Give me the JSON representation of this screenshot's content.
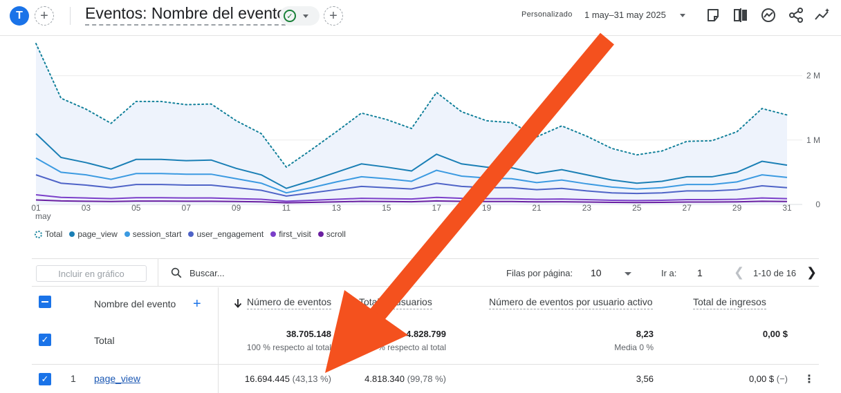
{
  "header": {
    "avatar_letter": "T",
    "title": "Eventos: Nombre del evento",
    "date_label": "Personalizado",
    "date_range": "1 may–31 may 2025",
    "add_comparison_glyph": "+",
    "add_report_glyph": "+"
  },
  "legend": {
    "items": [
      {
        "label": "Total",
        "color": "#12809a"
      },
      {
        "label": "page_view",
        "color": "#1a7fb5"
      },
      {
        "label": "session_start",
        "color": "#3b9ae1"
      },
      {
        "label": "user_engagement",
        "color": "#4e63c7"
      },
      {
        "label": "first_visit",
        "color": "#7b3fc9"
      },
      {
        "label": "scroll",
        "color": "#6a1fa0"
      }
    ]
  },
  "chart_data": {
    "type": "line",
    "x": [
      "01",
      "02",
      "03",
      "04",
      "05",
      "06",
      "07",
      "08",
      "09",
      "10",
      "11",
      "12",
      "13",
      "14",
      "15",
      "16",
      "17",
      "18",
      "19",
      "20",
      "21",
      "22",
      "23",
      "24",
      "25",
      "26",
      "27",
      "28",
      "29",
      "30",
      "31"
    ],
    "x_tick_labels": [
      "01",
      "03",
      "05",
      "07",
      "09",
      "11",
      "13",
      "15",
      "17",
      "19",
      "21",
      "23",
      "25",
      "27",
      "29",
      "31"
    ],
    "x_sub_label": "may",
    "y_tick_labels": [
      "0",
      "1 M",
      "2 M"
    ],
    "ylim": [
      0,
      2500000
    ],
    "grid": true,
    "series": [
      {
        "name": "Total",
        "style": "dotted-area",
        "color": "#12809a",
        "values": [
          2500000,
          1650000,
          1480000,
          1260000,
          1600000,
          1600000,
          1550000,
          1560000,
          1300000,
          1100000,
          580000,
          850000,
          1130000,
          1420000,
          1320000,
          1180000,
          1740000,
          1440000,
          1300000,
          1270000,
          1050000,
          1220000,
          1060000,
          870000,
          770000,
          830000,
          980000,
          990000,
          1130000,
          1490000,
          1390000
        ]
      },
      {
        "name": "page_view",
        "color": "#1a7fb5",
        "values": [
          1100000,
          730000,
          650000,
          550000,
          700000,
          700000,
          680000,
          690000,
          560000,
          460000,
          250000,
          370000,
          500000,
          630000,
          580000,
          520000,
          780000,
          630000,
          580000,
          570000,
          480000,
          540000,
          460000,
          380000,
          330000,
          360000,
          430000,
          430000,
          500000,
          670000,
          610000
        ]
      },
      {
        "name": "session_start",
        "color": "#3b9ae1",
        "values": [
          720000,
          500000,
          460000,
          390000,
          480000,
          480000,
          470000,
          470000,
          400000,
          330000,
          180000,
          260000,
          350000,
          430000,
          400000,
          360000,
          530000,
          440000,
          410000,
          400000,
          340000,
          380000,
          320000,
          270000,
          240000,
          260000,
          310000,
          310000,
          350000,
          460000,
          420000
        ]
      },
      {
        "name": "user_engagement",
        "color": "#4e63c7",
        "values": [
          460000,
          330000,
          300000,
          260000,
          310000,
          310000,
          300000,
          300000,
          260000,
          220000,
          130000,
          180000,
          230000,
          280000,
          260000,
          240000,
          330000,
          280000,
          260000,
          260000,
          230000,
          250000,
          210000,
          180000,
          170000,
          180000,
          210000,
          210000,
          230000,
          290000,
          260000
        ]
      },
      {
        "name": "first_visit",
        "color": "#7b3fc9",
        "values": [
          150000,
          110000,
          100000,
          90000,
          105000,
          105000,
          100000,
          100000,
          90000,
          80000,
          50000,
          65000,
          80000,
          95000,
          90000,
          85000,
          110000,
          95000,
          90000,
          90000,
          80000,
          85000,
          75000,
          65000,
          60000,
          65000,
          75000,
          75000,
          80000,
          100000,
          90000
        ]
      },
      {
        "name": "scroll",
        "color": "#6a1fa0",
        "values": [
          70000,
          55000,
          50000,
          45000,
          52000,
          52000,
          50000,
          50000,
          45000,
          40000,
          25000,
          32000,
          40000,
          48000,
          45000,
          42000,
          55000,
          48000,
          45000,
          45000,
          40000,
          42000,
          37000,
          32000,
          30000,
          32000,
          37000,
          37000,
          40000,
          50000,
          45000
        ]
      }
    ]
  },
  "toolbar": {
    "include_label": "Incluir en gráfico",
    "search_placeholder": "Buscar...",
    "rows_label": "Filas por página:",
    "rows_value": "10",
    "goto_label": "Ir a:",
    "goto_value": "1",
    "page_range": "1-10 de 16"
  },
  "table": {
    "columns": {
      "name": "Nombre del evento",
      "events": "Número de eventos",
      "users": "Total de usuarios",
      "per_user": "Número de eventos por usuario activo",
      "revenue": "Total de ingresos"
    },
    "total": {
      "label": "Total",
      "events": "38.705.148",
      "events_sub": "100 % respecto al total",
      "users": "4.828.799",
      "users_sub": "100 % respecto al total",
      "per_user": "8,23",
      "per_user_sub": "Media 0 %",
      "revenue": "0,00 $"
    },
    "rows": [
      {
        "index": "1",
        "name": "page_view",
        "events": "16.694.445",
        "events_pct": "(43,13 %)",
        "users": "4.818.340",
        "users_pct": "(99,78 %)",
        "per_user": "3,56",
        "revenue": "0,00 $",
        "revenue_pct": "(−)"
      }
    ]
  },
  "annotation": {
    "arrow_color": "#f4511e"
  }
}
